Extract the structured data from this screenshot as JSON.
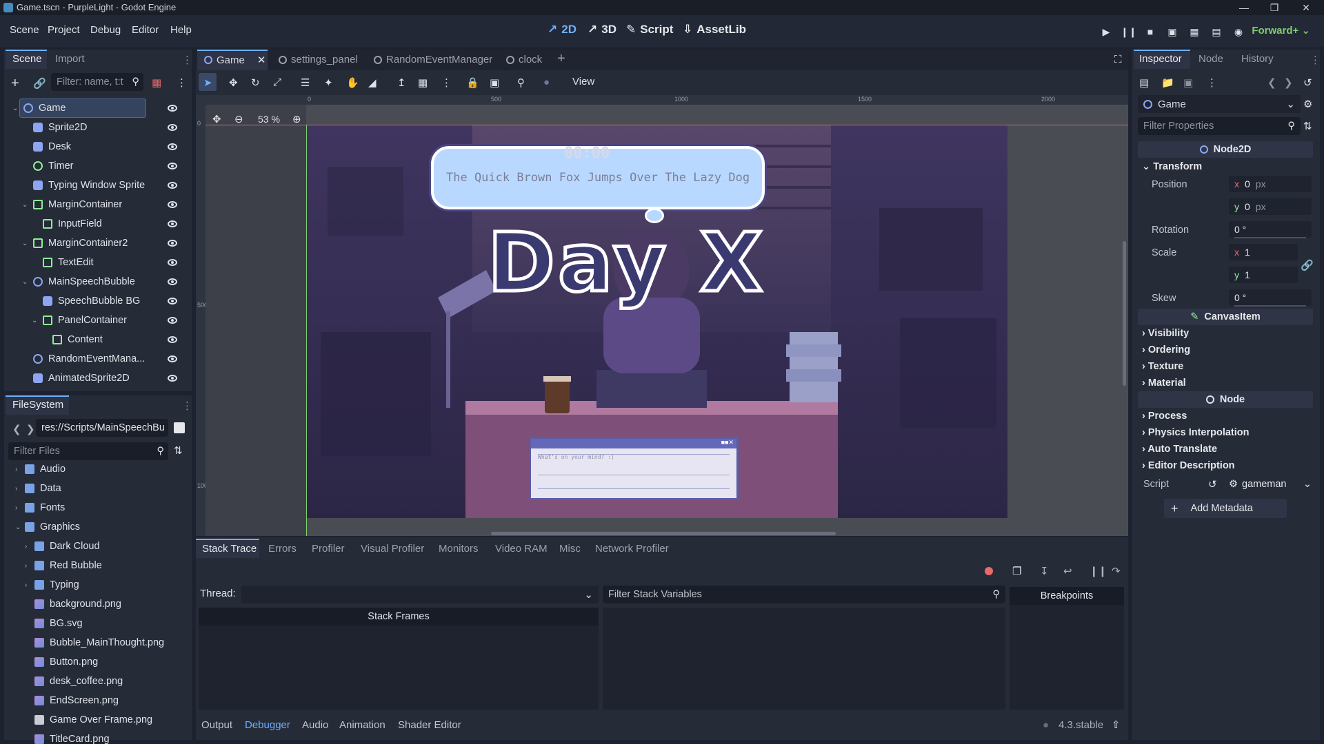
{
  "window": {
    "title": "Game.tscn - PurpleLight - Godot Engine"
  },
  "menu": {
    "items": [
      "Scene",
      "Project",
      "Debug",
      "Editor",
      "Help"
    ]
  },
  "workspaces": {
    "w2d": "2D",
    "w3d": "3D",
    "script": "Script",
    "assetlib": "AssetLib"
  },
  "renderer": "Forward+",
  "scene_dock": {
    "tabs": [
      "Scene",
      "Import"
    ],
    "filter_placeholder": "Filter: name, t:t",
    "nodes": [
      {
        "label": "Game",
        "icon": "node2d",
        "depth": 0
      },
      {
        "label": "Sprite2D",
        "icon": "sprite",
        "depth": 1
      },
      {
        "label": "Desk",
        "icon": "sprite",
        "depth": 1
      },
      {
        "label": "Timer",
        "icon": "timer",
        "depth": 1
      },
      {
        "label": "Typing Window Sprite",
        "icon": "sprite",
        "depth": 1
      },
      {
        "label": "MarginContainer",
        "icon": "control",
        "depth": 1
      },
      {
        "label": "InputField",
        "icon": "control",
        "depth": 2
      },
      {
        "label": "MarginContainer2",
        "icon": "control",
        "depth": 1
      },
      {
        "label": "TextEdit",
        "icon": "control",
        "depth": 2
      },
      {
        "label": "MainSpeechBubble",
        "icon": "node2d",
        "depth": 1
      },
      {
        "label": "SpeechBubble BG",
        "icon": "sprite",
        "depth": 2
      },
      {
        "label": "PanelContainer",
        "icon": "control",
        "depth": 2
      },
      {
        "label": "Content",
        "icon": "control",
        "depth": 3
      },
      {
        "label": "RandomEventMana...",
        "icon": "node2d",
        "depth": 1
      },
      {
        "label": "AnimatedSprite2D",
        "icon": "sprite",
        "depth": 1
      }
    ]
  },
  "filesystem": {
    "title": "FileSystem",
    "path": "res://Scripts/MainSpeechBu",
    "filter_placeholder": "Filter Files",
    "items": [
      {
        "label": "Audio",
        "type": "folder",
        "depth": 0
      },
      {
        "label": "Data",
        "type": "folder",
        "depth": 0
      },
      {
        "label": "Fonts",
        "type": "folder",
        "depth": 0
      },
      {
        "label": "Graphics",
        "type": "folder",
        "depth": 0
      },
      {
        "label": "Dark Cloud",
        "type": "folder",
        "depth": 1
      },
      {
        "label": "Red Bubble",
        "type": "folder",
        "depth": 1
      },
      {
        "label": "Typing",
        "type": "folder",
        "depth": 1
      },
      {
        "label": "background.png",
        "type": "image",
        "depth": 1
      },
      {
        "label": "BG.svg",
        "type": "image",
        "depth": 1
      },
      {
        "label": "Bubble_MainThought.png",
        "type": "image",
        "depth": 1
      },
      {
        "label": "Button.png",
        "type": "image",
        "depth": 1
      },
      {
        "label": "desk_coffee.png",
        "type": "image",
        "depth": 1
      },
      {
        "label": "EndScreen.png",
        "type": "image",
        "depth": 1
      },
      {
        "label": "Game Over Frame.png",
        "type": "file",
        "depth": 1
      },
      {
        "label": "TitleCard.png",
        "type": "image",
        "depth": 1
      }
    ]
  },
  "editor_tabs": [
    "Game",
    "settings_panel",
    "RandomEventManager",
    "clock"
  ],
  "toolbar": {
    "view_label": "View",
    "zoom": "53 %"
  },
  "ruler": {
    "marks": [
      "0",
      "500",
      "1000",
      "1500",
      "2000"
    ],
    "vmarks": [
      "0",
      "500",
      "1000"
    ]
  },
  "game": {
    "timer": "00:00",
    "bubble_text": "The Quick Brown Fox Jumps Over The Lazy Dog",
    "day_text": "Day X",
    "input_placeholder": "What's on your mind? :)"
  },
  "bottom_panel": {
    "tabs": [
      "Stack Trace",
      "Errors",
      "Profiler",
      "Visual Profiler",
      "Monitors",
      "Video RAM",
      "Misc",
      "Network Profiler"
    ],
    "thread_label": "Thread:",
    "filter_vars_placeholder": "Filter Stack Variables",
    "stack_frames": "Stack Frames",
    "breakpoints": "Breakpoints",
    "bottom_tabs": [
      "Output",
      "Debugger",
      "Audio",
      "Animation",
      "Shader Editor"
    ],
    "version": "4.3.stable"
  },
  "inspector": {
    "tabs": [
      "Inspector",
      "Node",
      "History"
    ],
    "object": "Game",
    "filter_placeholder": "Filter Properties",
    "class_node2d": "Node2D",
    "transform": "Transform",
    "position_label": "Position",
    "pos_x": "0",
    "pos_y": "0",
    "px": "px",
    "rotation_label": "Rotation",
    "rotation": "0 °",
    "scale_label": "Scale",
    "scale_x": "1",
    "scale_y": "1",
    "skew_label": "Skew",
    "skew": "0 °",
    "class_canvasitem": "CanvasItem",
    "canvas_groups": [
      "Visibility",
      "Ordering",
      "Texture",
      "Material"
    ],
    "class_node": "Node",
    "node_groups": [
      "Process",
      "Physics Interpolation",
      "Auto Translate",
      "Editor Description"
    ],
    "script_label": "Script",
    "script_value": "gameman",
    "add_metadata": "Add Metadata"
  },
  "colors": {
    "accent": "#6fb0ff",
    "renderer": "#7fcf6f",
    "node2d": "#8da5f3",
    "control": "#8eef97"
  }
}
